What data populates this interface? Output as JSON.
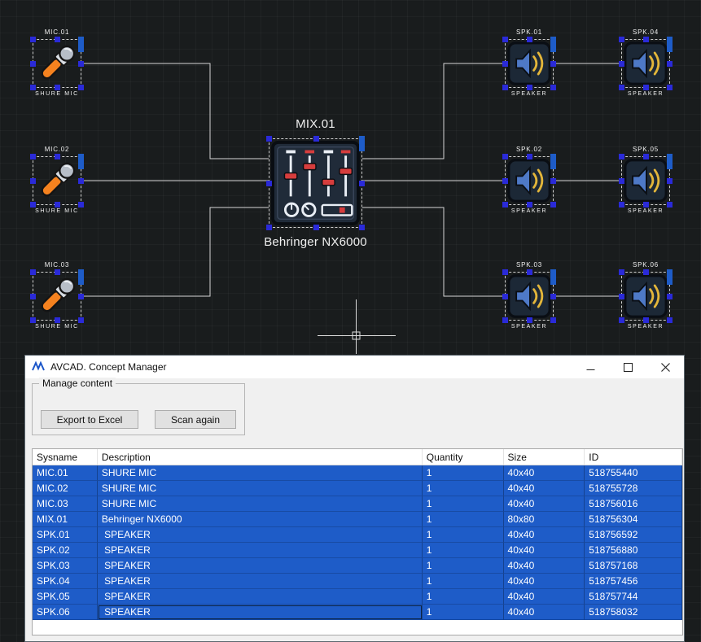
{
  "window": {
    "title": "AVCAD. Concept Manager"
  },
  "icons": {
    "app": "avcad-logo-icon",
    "minimize": "minimize-icon",
    "maximize": "maximize-icon",
    "close": "close-icon",
    "cursor": "crosshair-cursor"
  },
  "manage_content": {
    "legend": "Manage content",
    "buttons": [
      {
        "label": "Export to Excel"
      },
      {
        "label": "Scan again"
      }
    ]
  },
  "table": {
    "columns": [
      "Sysname",
      "Description",
      "Quantity",
      "Size",
      "ID"
    ],
    "rows": [
      [
        "MIC.01",
        "SHURE MIC",
        "1",
        "40x40",
        "518755440"
      ],
      [
        "MIC.02",
        "SHURE MIC",
        "1",
        "40x40",
        "518755728"
      ],
      [
        "MIC.03",
        "SHURE MIC",
        "1",
        "40x40",
        "518756016"
      ],
      [
        "MIX.01",
        "Behringer NX6000",
        "1",
        "80x80",
        "518756304"
      ],
      [
        "SPK.01",
        " SPEAKER",
        "1",
        "40x40",
        "518756592"
      ],
      [
        "SPK.02",
        " SPEAKER",
        "1",
        "40x40",
        "518756880"
      ],
      [
        "SPK.03",
        " SPEAKER",
        "1",
        "40x40",
        "518757168"
      ],
      [
        "SPK.04",
        " SPEAKER",
        "1",
        "40x40",
        "518757456"
      ],
      [
        "SPK.05",
        " SPEAKER",
        "1",
        "40x40",
        "518757744"
      ],
      [
        "SPK.06",
        " SPEAKER",
        "1",
        "40x40",
        "518758032"
      ]
    ]
  },
  "canvas": {
    "devices": [
      {
        "top": "MIC.01",
        "bottom": "SHURE MIC",
        "kind": "mic"
      },
      {
        "top": "MIC.02",
        "bottom": "SHURE MIC",
        "kind": "mic"
      },
      {
        "top": "MIC.03",
        "bottom": "SHURE MIC",
        "kind": "mic"
      },
      {
        "top": "MIX.01",
        "bottom": "Behringer NX6000",
        "kind": "mixer"
      },
      {
        "top": "SPK.01",
        "bottom": "SPEAKER",
        "kind": "speaker"
      },
      {
        "top": "SPK.02",
        "bottom": "SPEAKER",
        "kind": "speaker"
      },
      {
        "top": "SPK.03",
        "bottom": "SPEAKER",
        "kind": "speaker"
      },
      {
        "top": "SPK.04",
        "bottom": "SPEAKER",
        "kind": "speaker"
      },
      {
        "top": "SPK.05",
        "bottom": "SPEAKER",
        "kind": "speaker"
      },
      {
        "top": "SPK.06",
        "bottom": "SPEAKER",
        "kind": "speaker"
      }
    ]
  },
  "colors": {
    "canvas_bg": "#191c1d",
    "selection_blue": "#1e5cc8",
    "handle_blue": "#2a2ad8",
    "wire": "#d6d6d6",
    "mic_orange": "#f5821f",
    "speaker_blue": "#4e79c7",
    "wave_yellow": "#e3b63a",
    "fader_red": "#d63d3d"
  }
}
